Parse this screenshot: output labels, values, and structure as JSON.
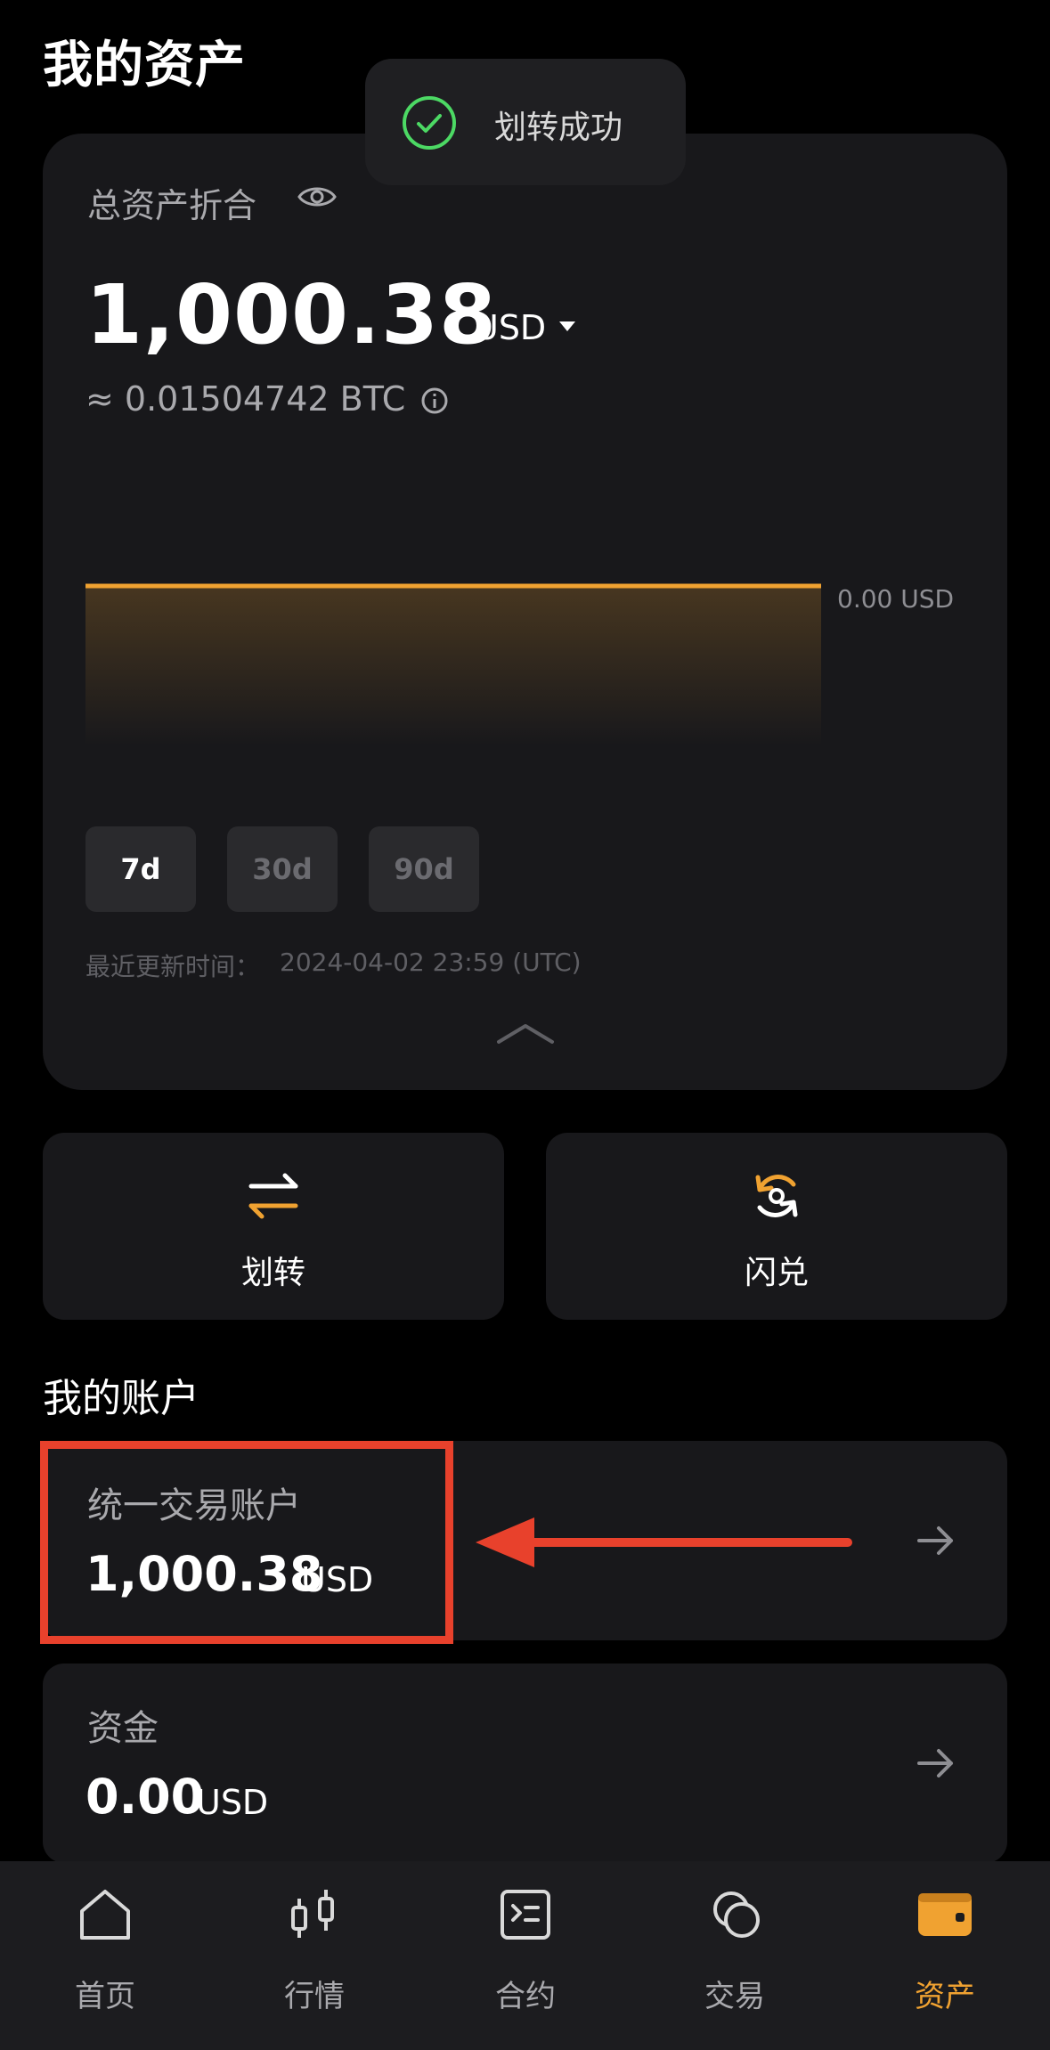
{
  "page": {
    "title": "我的资产"
  },
  "toast": {
    "text": "划转成功",
    "icon": "check-circle-icon",
    "color": "#4cd964"
  },
  "asset": {
    "label": "总资产折合",
    "amount": "1,000.38",
    "unit": "USD",
    "btc_equiv": "≈ 0.01504742 BTC",
    "chart_value_label": "0.00 USD",
    "ranges": [
      "7d",
      "30d",
      "90d"
    ],
    "selected_range": "7d",
    "updated_label": "最近更新时间：",
    "updated_value": "2024-04-02 23:59 (UTC)"
  },
  "actions": [
    {
      "label": "划转",
      "icon": "transfer-icon"
    },
    {
      "label": "闪兑",
      "icon": "convert-icon"
    }
  ],
  "accounts_section": {
    "title": "我的账户",
    "items": [
      {
        "name": "统一交易账户",
        "amount": "1,000.38",
        "unit": "USD"
      },
      {
        "name": "资金",
        "amount": "0.00",
        "unit": "USD"
      }
    ]
  },
  "nav": {
    "items": [
      {
        "label": "首页",
        "icon": "home-icon"
      },
      {
        "label": "行情",
        "icon": "candlestick-icon"
      },
      {
        "label": "合约",
        "icon": "contract-icon"
      },
      {
        "label": "交易",
        "icon": "trade-icon"
      },
      {
        "label": "资产",
        "icon": "wallet-icon"
      }
    ],
    "active": "资产"
  },
  "colors": {
    "accent": "#f0a231",
    "highlight": "#e8412c",
    "card": "#18181b",
    "success": "#4cd964"
  }
}
